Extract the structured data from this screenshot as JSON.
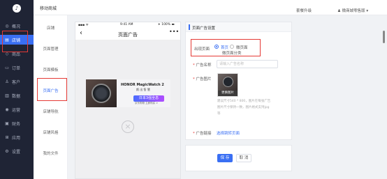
{
  "nav": {
    "logo": "♪",
    "items": [
      {
        "label": "概况",
        "icon": "◎"
      },
      {
        "label": "店铺",
        "icon": "▤"
      },
      {
        "label": "商品",
        "icon": "◇"
      },
      {
        "label": "订单",
        "icon": "▭"
      },
      {
        "label": "客户",
        "icon": "♙"
      },
      {
        "label": "数据",
        "icon": "▥"
      },
      {
        "label": "运营",
        "icon": "◉"
      },
      {
        "label": "财务",
        "icon": "▣"
      },
      {
        "label": "应用",
        "icon": "⊞"
      },
      {
        "label": "设置",
        "icon": "⚙"
      }
    ]
  },
  "subnav": {
    "items": [
      "店铺",
      "页面管理",
      "页面模板",
      "页面广告",
      "店铺导航",
      "店铺风格",
      "我的文件"
    ]
  },
  "topbar": {
    "title": "移动商城",
    "upgrade": "套餐升级",
    "account": "♟ 微商城零售版 ▾"
  },
  "phone": {
    "carrier": "▪▪▪ ᯤ",
    "time": "9:41 AM",
    "battery": "∗ 100% ▬",
    "back": "‹",
    "title": "页面广告",
    "more": "•••",
    "ad": {
      "brand": "HONOR MagicWatch 2",
      "line1": "颜 出 智 慧",
      "line2": "",
      "badge": "日本3强全息",
      "small": "京东购物 立即购买 >"
    },
    "close": "×"
  },
  "panel": {
    "heading": "页面广告设置",
    "show_page_label": "出现页面",
    "radio_home": "首页",
    "radio_micro": "微页面",
    "radio_sub": "微页面分类",
    "name_label": "广告名称",
    "name_placeholder": "请输入广告名称",
    "image_label": "广告图片",
    "change_image": "更换图片",
    "hint1": "建议尺寸540 * 800，图片在每张广告",
    "hint2": "图片尺寸保持一致，图片格式支持jpg",
    "hint3": "等",
    "link_label": "广告链接",
    "link_value": "选择跳转页面",
    "save": "保 存",
    "cancel": "取 消"
  }
}
